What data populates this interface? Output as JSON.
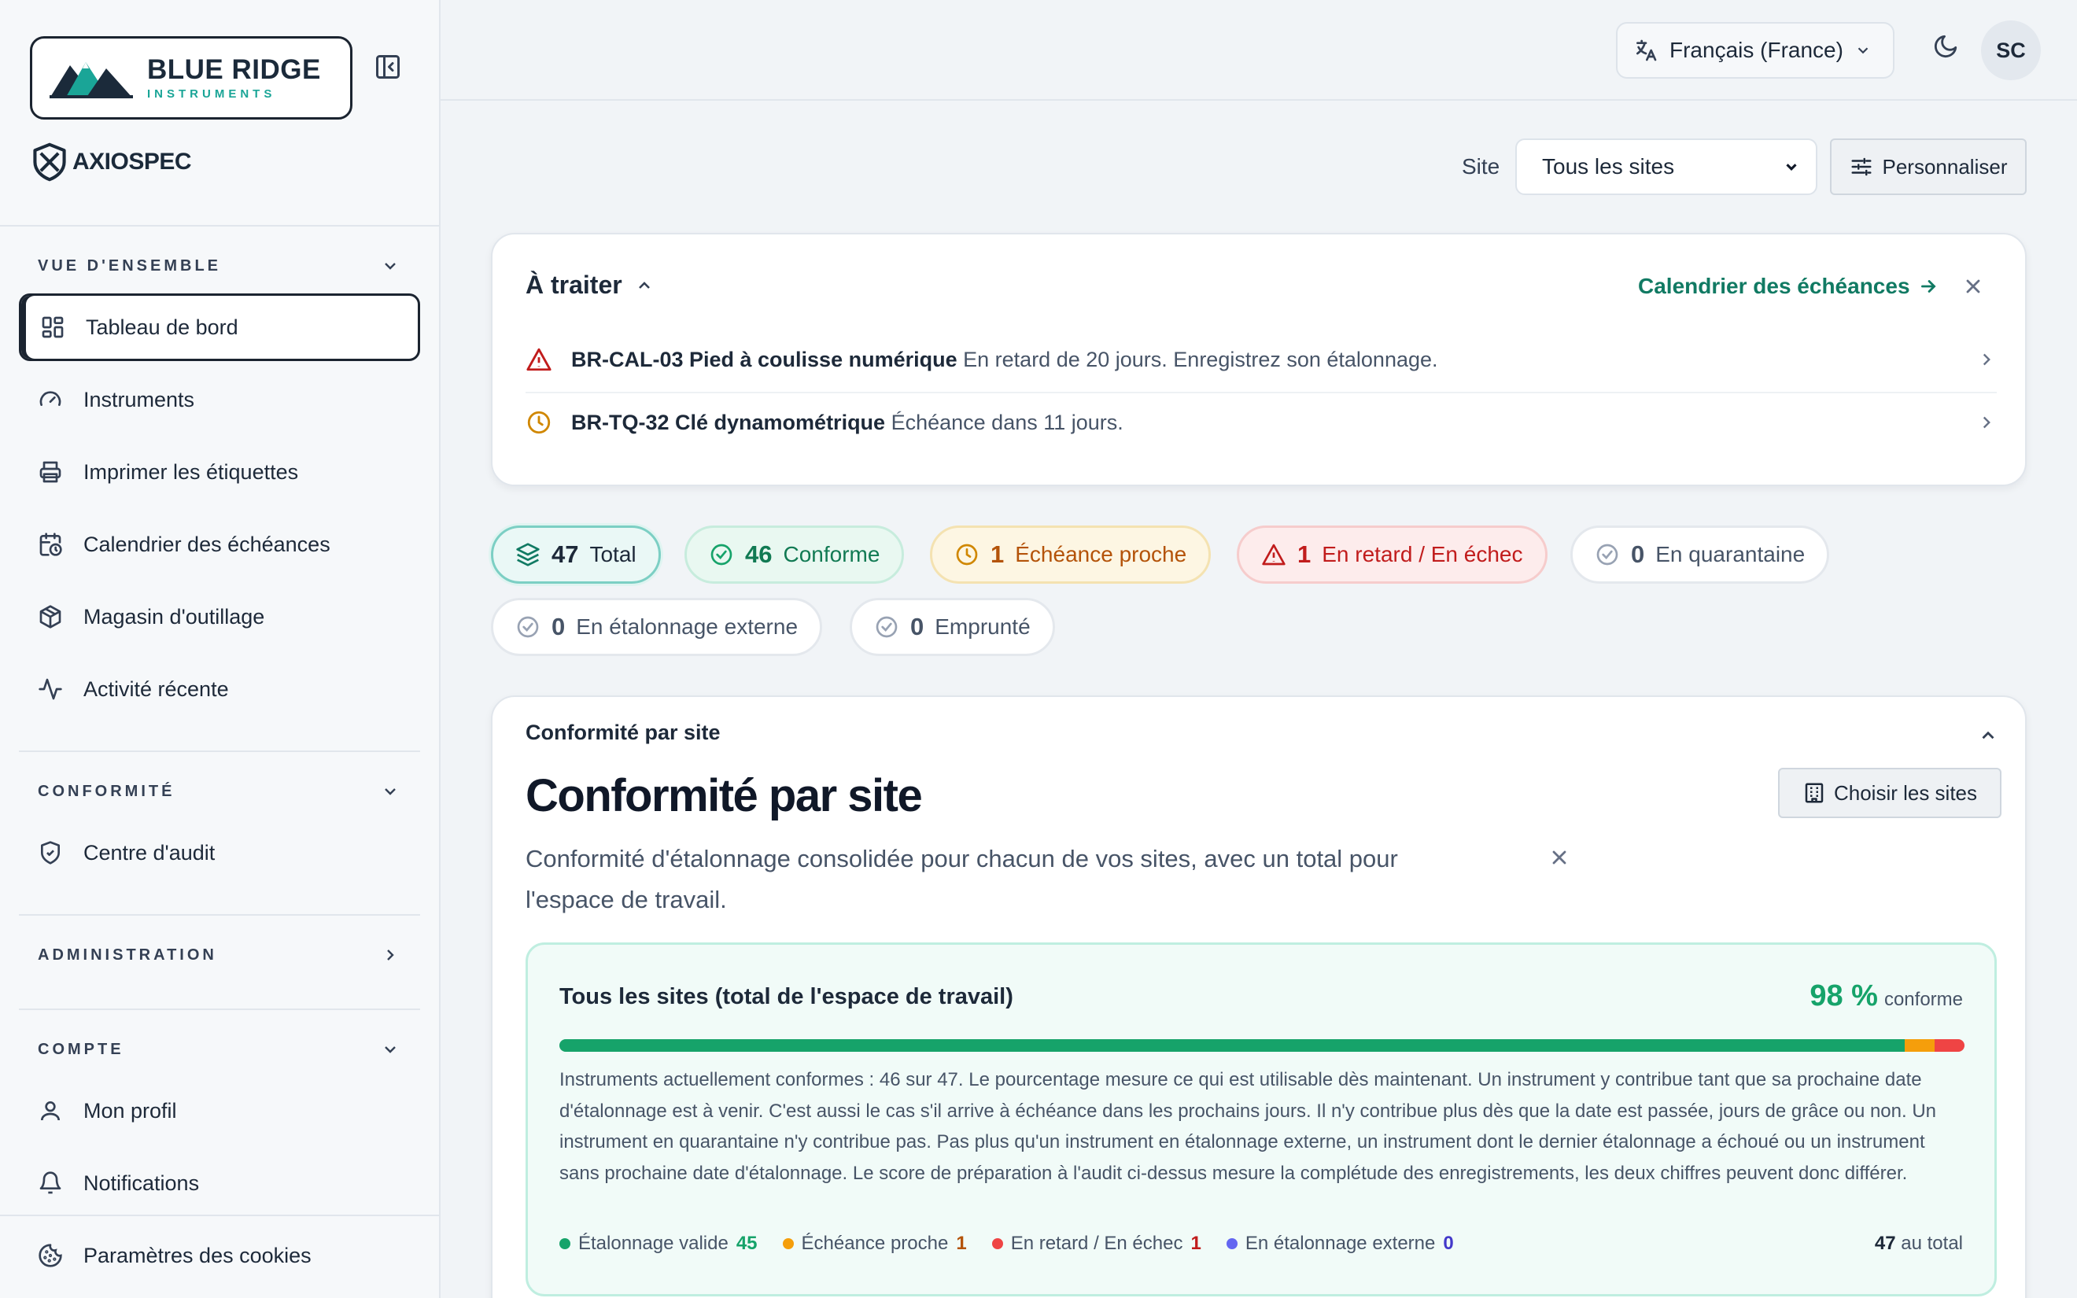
{
  "brand": {
    "name": "BLUE RIDGE",
    "sub": "INSTRUMENTS",
    "product": "AXIOSPEC"
  },
  "sidebar": {
    "groups": {
      "overview": "VUE D'ENSEMBLE",
      "compliance": "CONFORMITÉ",
      "admin": "ADMINISTRATION",
      "account": "COMPTE"
    },
    "items": [
      {
        "label": "Tableau de bord"
      },
      {
        "label": "Instruments"
      },
      {
        "label": "Imprimer les étiquettes"
      },
      {
        "label": "Calendrier des échéances"
      },
      {
        "label": "Magasin d'outillage"
      },
      {
        "label": "Activité récente"
      },
      {
        "label": "Centre d'audit"
      },
      {
        "label": "Mon profil"
      },
      {
        "label": "Notifications"
      },
      {
        "label": "Paramètres des cookies"
      }
    ]
  },
  "topbar": {
    "language": "Français (France)",
    "avatar": "SC"
  },
  "toolbar": {
    "site_label": "Site",
    "site_value": "Tous les sites",
    "customize": "Personnaliser"
  },
  "todo": {
    "title": "À traiter",
    "link": "Calendrier des échéances",
    "items": [
      {
        "code": "BR-CAL-03 Pied à coulisse numérique",
        "text": "En retard de 20 jours. Enregistrez son étalonnage."
      },
      {
        "code": "BR-TQ-32 Clé dynamométrique",
        "text": "Échéance dans 11 jours."
      }
    ]
  },
  "chips": [
    {
      "num": "47",
      "label": "Total"
    },
    {
      "num": "46",
      "label": "Conforme"
    },
    {
      "num": "1",
      "label": "Échéance proche"
    },
    {
      "num": "1",
      "label": "En retard / En échec"
    },
    {
      "num": "0",
      "label": "En quarantaine"
    },
    {
      "num": "0",
      "label": "En étalonnage externe"
    },
    {
      "num": "0",
      "label": "Emprunté"
    }
  ],
  "compliance": {
    "small_title": "Conformité par site",
    "title": "Conformité par site",
    "choose": "Choisir les sites",
    "desc": "Conformité d'étalonnage consolidée pour chacun de vos sites, avec un total pour l'espace de travail.",
    "overall": {
      "title": "Tous les sites (total de l'espace de travail)",
      "pct": "98 %",
      "pct_suffix": "conforme",
      "text": "Instruments actuellement conformes : 46 sur 47. Le pourcentage mesure ce qui est utilisable dès maintenant. Un instrument y contribue tant que sa prochaine date d'étalonnage est à venir. C'est aussi le cas s'il arrive à échéance dans les prochains jours. Il n'y contribue plus dès que la date est passée, jours de grâce ou non. Un instrument en quarantaine n'y contribue pas. Pas plus qu'un instrument en étalonnage externe, un instrument dont le dernier étalonnage a échoué ou un instrument sans prochaine date d'étalonnage. Le score de préparation à l'audit ci-dessus mesure la complétude des enregistrements, les deux chiffres peuvent donc différer.",
      "legend": [
        {
          "label": "Étalonnage valide",
          "value": "45",
          "color": "#16a36a"
        },
        {
          "label": "Échéance proche",
          "value": "1",
          "color": "#f59e0b"
        },
        {
          "label": "En retard / En échec",
          "value": "1",
          "color": "#ef4444"
        },
        {
          "label": "En étalonnage externe",
          "value": "0",
          "color": "#6366f1"
        }
      ],
      "bar_fractions": {
        "valid": 0.9574,
        "due": 0.0213,
        "late": 0.0213
      },
      "total_num": "47",
      "total_suffix": "au total"
    }
  },
  "colors": {
    "accent": "#117a63",
    "sidebar_active": "#1b2430"
  }
}
